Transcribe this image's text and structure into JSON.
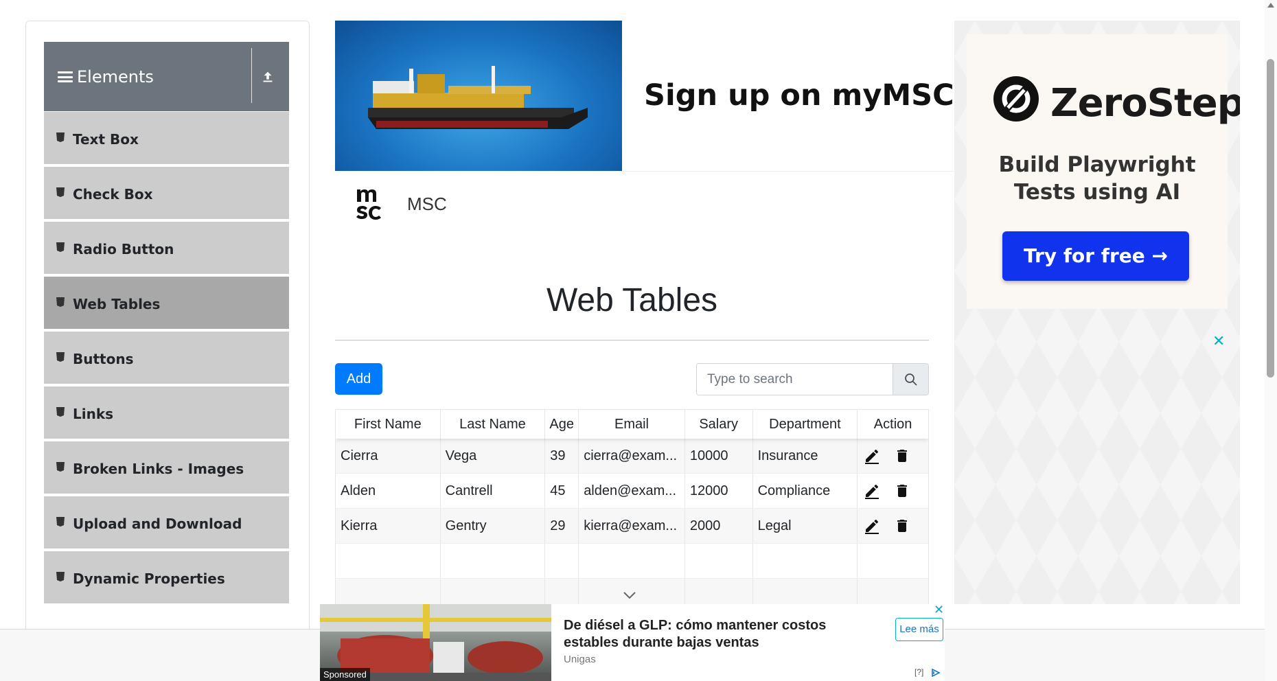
{
  "sidebar": {
    "group_title": "Elements",
    "items": [
      {
        "label": "Text Box",
        "active": false
      },
      {
        "label": "Check Box",
        "active": false
      },
      {
        "label": "Radio Button",
        "active": false
      },
      {
        "label": "Web Tables",
        "active": true
      },
      {
        "label": "Buttons",
        "active": false
      },
      {
        "label": "Links",
        "active": false
      },
      {
        "label": "Broken Links - Images",
        "active": false
      },
      {
        "label": "Upload and Download",
        "active": false
      },
      {
        "label": "Dynamic Properties",
        "active": false
      }
    ]
  },
  "banner_ad": {
    "headline": "Sign up on myMSC & B",
    "advertiser": "MSC"
  },
  "main": {
    "title": "Web Tables",
    "add_label": "Add",
    "search_placeholder": "Type to search"
  },
  "table": {
    "headers": [
      "First Name",
      "Last Name",
      "Age",
      "Email",
      "Salary",
      "Department",
      "Action"
    ],
    "rows": [
      {
        "first": "Cierra",
        "last": "Vega",
        "age": "39",
        "email": "cierra@exam...",
        "salary": "10000",
        "department": "Insurance"
      },
      {
        "first": "Alden",
        "last": "Cantrell",
        "age": "45",
        "email": "alden@exam...",
        "salary": "12000",
        "department": "Compliance"
      },
      {
        "first": "Kierra",
        "last": "Gentry",
        "age": "29",
        "email": "kierra@exam...",
        "salary": "2000",
        "department": "Legal"
      }
    ]
  },
  "right_ad": {
    "brand": "ZeroStep",
    "subtitle": "Build Playwright Tests using AI",
    "cta": "Try for free →",
    "close": "✕"
  },
  "bottom_ad": {
    "headline": "De diésel a GLP: cómo mantener costos estables durante bajas ventas",
    "advertiser": "Unigas",
    "cta": "Lee más",
    "sponsored": "Sponsored",
    "close": "✕",
    "adchoices": "[?]"
  },
  "colors": {
    "accent": "#007bff",
    "sidebar_header": "#6c757d",
    "sidebar_item": "#cccccc",
    "sidebar_active": "#a8a8a8",
    "cta_blue": "#1133ee"
  }
}
